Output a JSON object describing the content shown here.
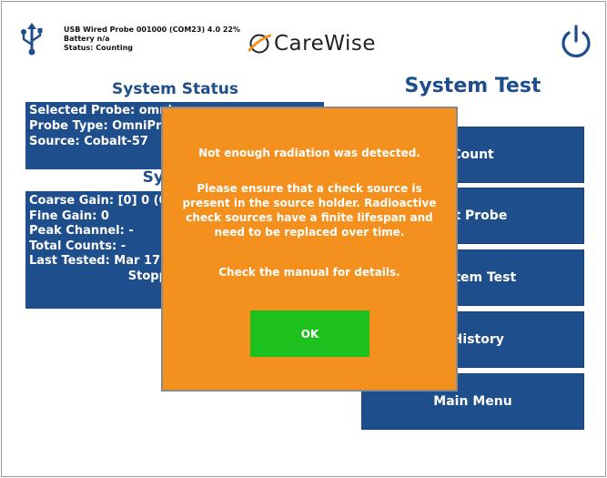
{
  "header": {
    "device_line1": "USB Wired Probe 001000 (COM23) 4.0 22%",
    "device_line2": "Battery n/a",
    "device_line3": "Status: Counting",
    "logo_text": "CareWise",
    "icons": [
      "usb-icon",
      "carewise-logo-icon",
      "power-icon"
    ]
  },
  "status": {
    "title": "System Status",
    "rows": [
      "Selected Probe: omni",
      "Probe Type: OmniPro",
      "Source: Cobalt-57"
    ],
    "subtitle": "System",
    "rows2": [
      "Coarse Gain: [0] 0 (0)",
      "Fine Gain: 0",
      "Peak Channel: -",
      "Total Counts: -",
      "Last Tested: Mar 17, 2"
    ],
    "status_line": "Stopped (insu"
  },
  "test": {
    "title": "System Test",
    "buttons": [
      "Count",
      "ect Probe",
      "System Test",
      "t History",
      "Main Menu"
    ]
  },
  "dialog": {
    "message1": "Not enough radiation was detected.",
    "message2": "Please ensure that a check source is present in the source holder. Radioactive check sources have a finite lifespan and need to be replaced over time.",
    "message3": "Check the manual for details.",
    "ok_label": "OK"
  },
  "colors": {
    "primary": "#1f4e8c",
    "dialog_bg": "#f4911e",
    "ok_bg": "#1dc11d"
  }
}
